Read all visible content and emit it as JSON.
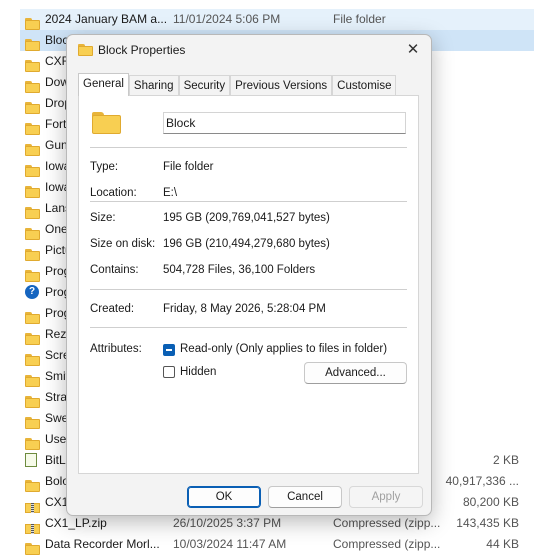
{
  "explorer": {
    "rows": [
      {
        "icon": "folder-icon",
        "name": "2024 January BAM a...",
        "date": "11/01/2024 5:06 PM",
        "type": "File folder",
        "size": "",
        "state": "sel"
      },
      {
        "icon": "folder-icon",
        "name": "Block",
        "date": "",
        "type": "",
        "size": "",
        "state": "hover"
      },
      {
        "icon": "folder-icon",
        "name": "CXR",
        "date": "",
        "type": "",
        "size": "",
        "state": ""
      },
      {
        "icon": "folder-icon",
        "name": "Dow",
        "date": "",
        "type": "",
        "size": "",
        "state": ""
      },
      {
        "icon": "folder-icon",
        "name": "Drop",
        "date": "",
        "type": "",
        "size": "",
        "state": ""
      },
      {
        "icon": "folder-icon",
        "name": "Forti",
        "date": "",
        "type": "",
        "size": "",
        "state": ""
      },
      {
        "icon": "folder-icon",
        "name": "Gun",
        "date": "",
        "type": "",
        "size": "",
        "state": ""
      },
      {
        "icon": "folder-icon",
        "name": "Iowa",
        "date": "",
        "type": "",
        "size": "",
        "state": ""
      },
      {
        "icon": "folder-icon",
        "name": "Iowa",
        "date": "",
        "type": "",
        "size": "",
        "state": ""
      },
      {
        "icon": "folder-icon",
        "name": "Lans",
        "date": "",
        "type": "",
        "size": "",
        "state": ""
      },
      {
        "icon": "folder-icon",
        "name": "One",
        "date": "",
        "type": "",
        "size": "",
        "state": ""
      },
      {
        "icon": "folder-icon",
        "name": "Pictu",
        "date": "",
        "type": "",
        "size": "",
        "state": ""
      },
      {
        "icon": "folder-icon",
        "name": "Prog",
        "date": "",
        "type": "",
        "size": "",
        "state": ""
      },
      {
        "icon": "help-icon",
        "name": "Prog",
        "date": "",
        "type": "",
        "size": "",
        "state": ""
      },
      {
        "icon": "folder-icon",
        "name": "Prog",
        "date": "",
        "type": "",
        "size": "",
        "state": ""
      },
      {
        "icon": "folder-icon",
        "name": "Rezz",
        "date": "",
        "type": "",
        "size": "",
        "state": ""
      },
      {
        "icon": "folder-icon",
        "name": "Scre",
        "date": "",
        "type": "",
        "size": "",
        "state": ""
      },
      {
        "icon": "folder-icon",
        "name": "Smit",
        "date": "",
        "type": "",
        "size": "",
        "state": ""
      },
      {
        "icon": "folder-icon",
        "name": "Stran",
        "date": "",
        "type": "",
        "size": "",
        "state": ""
      },
      {
        "icon": "folder-icon",
        "name": "Swe",
        "date": "",
        "type": "",
        "size": "",
        "state": ""
      },
      {
        "icon": "folder-icon",
        "name": "User",
        "date": "",
        "type": "",
        "size": "",
        "state": ""
      },
      {
        "icon": "text-file-icon",
        "name": "BitLo",
        "date": "",
        "type": "",
        "size": "2 KB",
        "state": ""
      },
      {
        "icon": "folder-icon",
        "name": "Bolo",
        "date": "",
        "type": "",
        "size": "40,917,336 ...",
        "state": ""
      },
      {
        "icon": "zip-icon",
        "name": "CX1",
        "date": "",
        "type": "",
        "size": "80,200 KB",
        "state": ""
      },
      {
        "icon": "zip-icon",
        "name": "CX1_LP.zip",
        "date": "26/10/2025 3:37 PM",
        "type": "Compressed (zipp...",
        "size": "143,435 KB",
        "state": ""
      },
      {
        "icon": "folder-icon",
        "name": "Data Recorder Morl...",
        "date": "10/03/2024 11:47 AM",
        "type": "Compressed (zipp...",
        "size": "44 KB",
        "state": ""
      }
    ]
  },
  "dialog": {
    "title": "Block Properties",
    "close_glyph": "✕",
    "tabs": [
      "General",
      "Sharing",
      "Security",
      "Previous Versions",
      "Customise"
    ],
    "active_tab": "General",
    "folder_name": "Block",
    "type_label": "Type:",
    "type_value": "File folder",
    "location_label": "Location:",
    "location_value": "E:\\",
    "size_label": "Size:",
    "size_value": "195 GB (209,769,041,527 bytes)",
    "size_on_disk_label": "Size on disk:",
    "size_on_disk_value": "196 GB (210,494,279,680 bytes)",
    "contains_label": "Contains:",
    "contains_value": "504,728 Files, 36,100 Folders",
    "created_label": "Created:",
    "created_value": "Friday, 8 May 2026, 5:28:04 PM",
    "attributes_label": "Attributes:",
    "readonly_label": "Read-only (Only applies to files in folder)",
    "readonly_state": "indeterminate",
    "hidden_label": "Hidden",
    "hidden_state": "unchecked",
    "advanced_label": "Advanced...",
    "ok_label": "OK",
    "cancel_label": "Cancel",
    "apply_label": "Apply"
  },
  "colors": {
    "accent": "#0a5fb4",
    "folder": "#f8cf52",
    "selection": "#e5f1fb"
  }
}
